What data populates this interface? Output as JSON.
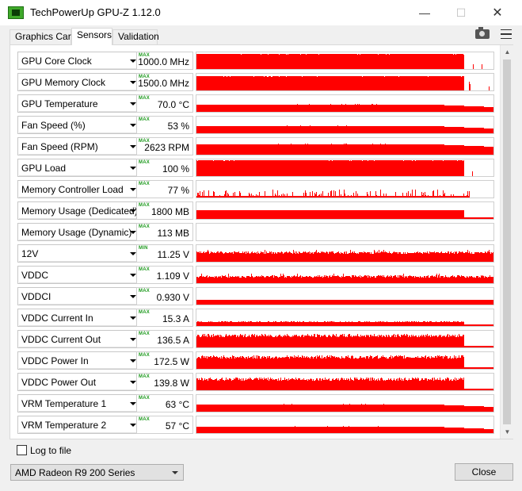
{
  "window": {
    "title": "TechPowerUp GPU-Z 1.12.0",
    "minimize_glyph": "—",
    "maximize_glyph": "☐",
    "close_glyph": "✕"
  },
  "tabs": [
    {
      "label": "Graphics Card"
    },
    {
      "label": "Sensors"
    },
    {
      "label": "Validation"
    }
  ],
  "active_tab": "Sensors",
  "graph_color": "#ff0000",
  "tag_color": "#1e9a1e",
  "sensors": [
    {
      "name": "GPU Core Clock",
      "tag": "MAX",
      "value": "1000.0 MHz",
      "level": 0.9,
      "shape": "plateau_drop_spikes"
    },
    {
      "name": "GPU Memory Clock",
      "tag": "MAX",
      "value": "1500.0 MHz",
      "level": 0.85,
      "shape": "plateau_drop_spikes"
    },
    {
      "name": "GPU Temperature",
      "tag": "MAX",
      "value": "70.0 °C",
      "level": 0.45,
      "shape": "plateau_slow"
    },
    {
      "name": "Fan Speed (%)",
      "tag": "MAX",
      "value": "53 %",
      "level": 0.45,
      "shape": "plateau_slow"
    },
    {
      "name": "Fan Speed (RPM)",
      "tag": "MAX",
      "value": "2623 RPM",
      "level": 0.6,
      "shape": "plateau_slow"
    },
    {
      "name": "GPU Load",
      "tag": "MAX",
      "value": "100 %",
      "level": 0.95,
      "shape": "plateau_drop_spikes"
    },
    {
      "name": "Memory Controller Load",
      "tag": "MAX",
      "value": "77 %",
      "level": 0.35,
      "shape": "spiky"
    },
    {
      "name": "Memory Usage (Dedicated)",
      "tag": "MAX",
      "value": "1800 MB",
      "level": 0.5,
      "shape": "plateau_low_tail"
    },
    {
      "name": "Memory Usage (Dynamic)",
      "tag": "MAX",
      "value": "113 MB",
      "level": 0.0,
      "shape": "flat"
    },
    {
      "name": "12V",
      "tag": "MIN",
      "value": "11.25 V",
      "level": 0.55,
      "shape": "noisy_full"
    },
    {
      "name": "VDDC",
      "tag": "MAX",
      "value": "1.109 V",
      "level": 0.45,
      "shape": "noisy_full"
    },
    {
      "name": "VDDCI",
      "tag": "MAX",
      "value": "0.930 V",
      "level": 0.3,
      "shape": "plateau_full"
    },
    {
      "name": "VDDC Current In",
      "tag": "MAX",
      "value": "15.3 A",
      "level": 0.3,
      "shape": "noisy_drop"
    },
    {
      "name": "VDDC Current Out",
      "tag": "MAX",
      "value": "136.5 A",
      "level": 0.8,
      "shape": "noisy_drop"
    },
    {
      "name": "VDDC Power In",
      "tag": "MAX",
      "value": "172.5 W",
      "level": 0.8,
      "shape": "noisy_drop"
    },
    {
      "name": "VDDC Power Out",
      "tag": "MAX",
      "value": "139.8 W",
      "level": 0.75,
      "shape": "noisy_drop"
    },
    {
      "name": "VRM Temperature 1",
      "tag": "MAX",
      "value": "63 °C",
      "level": 0.45,
      "shape": "plateau_slow"
    },
    {
      "name": "VRM Temperature 2",
      "tag": "MAX",
      "value": "57 °C",
      "level": 0.4,
      "shape": "plateau_slow"
    }
  ],
  "footer": {
    "log_to_file_label": "Log to file",
    "log_to_file_checked": false,
    "gpu_selected": "AMD Radeon R9 200 Series",
    "close_label": "Close"
  }
}
